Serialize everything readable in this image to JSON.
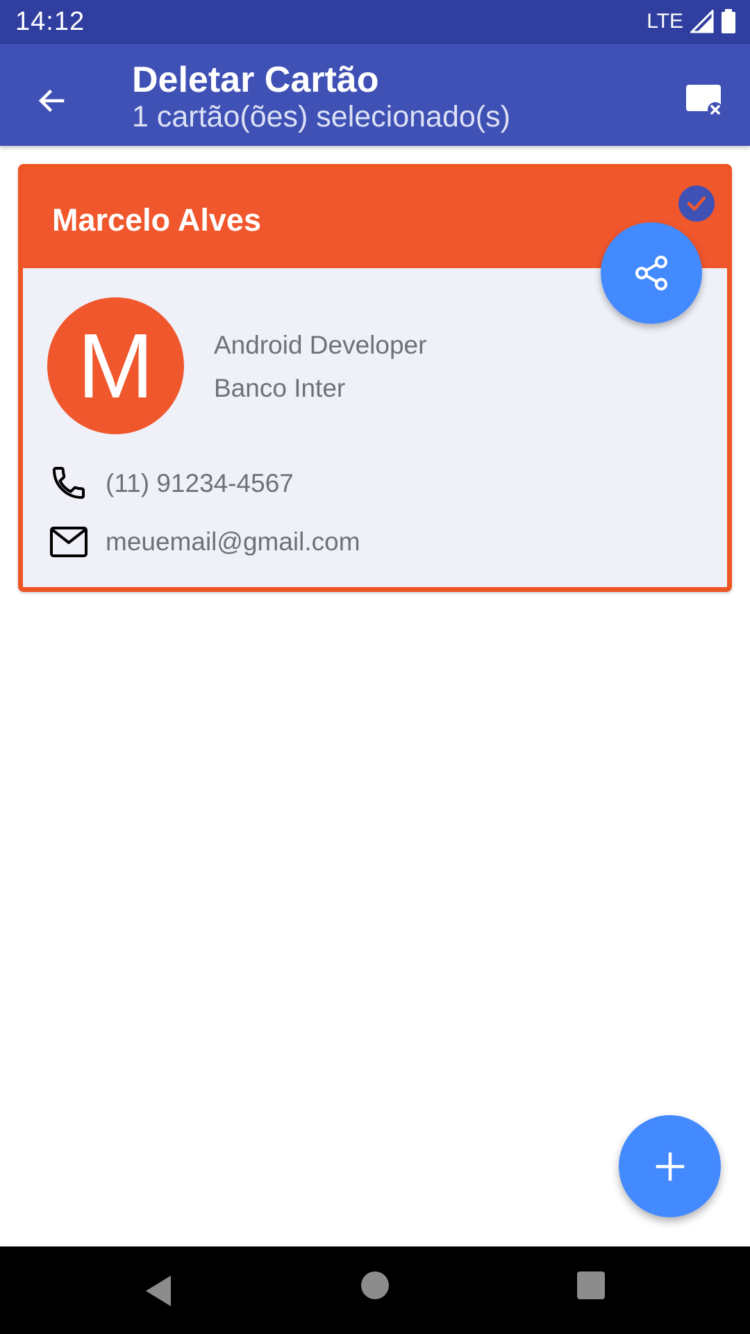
{
  "status_bar": {
    "time": "14:12",
    "network": "LTE",
    "icons": [
      "signal-icon",
      "battery-icon"
    ]
  },
  "app_bar": {
    "title": "Deletar Cartão",
    "subtitle": "1 cartão(ões) selecionado(s)",
    "back_icon": "arrow-back-icon",
    "action_icon": "card-remove-icon"
  },
  "card": {
    "name": "Marcelo Alves",
    "selected": true,
    "avatar_initial": "M",
    "job_title": "Android Developer",
    "company": "Banco Inter",
    "phone": "(11) 91234-4567",
    "email": "meuemail@gmail.com",
    "header_color": "#F0572D",
    "border_color": "#EE5525"
  },
  "fabs": {
    "share_icon": "share-icon",
    "add_icon": "plus-icon",
    "color": "#448AFF"
  },
  "colors": {
    "primary": "#3F51B5",
    "primary_dark": "#303F9F"
  },
  "nav_bar": {
    "icons": [
      "nav-back-icon",
      "nav-home-icon",
      "nav-recents-icon"
    ]
  }
}
